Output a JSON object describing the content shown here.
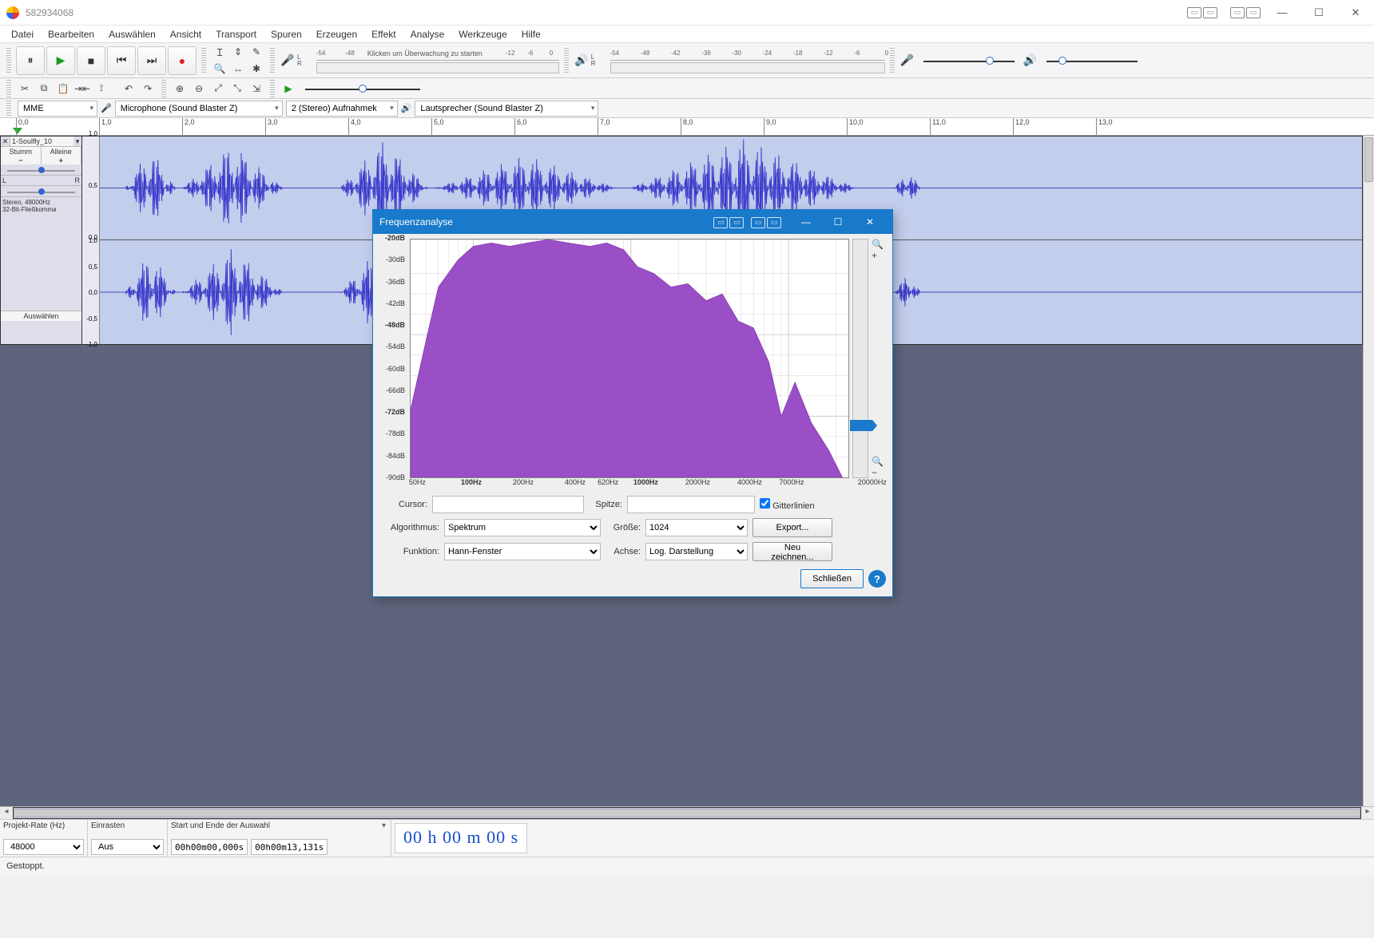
{
  "window": {
    "title": "582934068"
  },
  "menu": [
    "Datei",
    "Bearbeiten",
    "Auswählen",
    "Ansicht",
    "Transport",
    "Spuren",
    "Erzeugen",
    "Effekt",
    "Analyse",
    "Werkzeuge",
    "Hilfe"
  ],
  "meter_ticks": [
    "-54",
    "-48",
    "-42",
    "-36",
    "-30",
    "-24",
    "-18",
    "-12",
    "-6",
    "0"
  ],
  "rec_meter_hint": "Klicken um Überwachung zu starten",
  "rec_meter_left_ticks": [
    "-54",
    "-48"
  ],
  "rec_meter_right_ticks": [
    "-12",
    "-6",
    "0"
  ],
  "devices": {
    "host": "MME",
    "input": "Microphone (Sound Blaster Z)",
    "channels": "2 (Stereo) Aufnahmek",
    "output": "Lautsprecher (Sound Blaster Z)"
  },
  "ruler_ticks": [
    "0,0",
    "1,0",
    "2,0",
    "3,0",
    "4,0",
    "5,0",
    "6,0",
    "7,0",
    "8,0",
    "9,0",
    "10,0",
    "11,0",
    "12,0",
    "13,0"
  ],
  "track": {
    "name": "1-Soulfly_10",
    "mute": "Stumm",
    "solo": "Alleine",
    "L": "L",
    "R": "R",
    "info1": "Stereo, 48000Hz",
    "info2": "32-Bit-Fließkomma",
    "select": "Auswählen",
    "vticks": [
      "1,0",
      "0,5",
      "0,0",
      "-0,5",
      "-1,0"
    ]
  },
  "bottom": {
    "rate_label": "Projekt-Rate (Hz)",
    "rate_value": "48000",
    "snap_label": "Einrasten",
    "snap_value": "Aus",
    "sel_label": "Start und Ende der Auswahl",
    "sel_start": "00h00m00,000s",
    "sel_end": "00h00m13,131s",
    "timecode": "00 h 00 m 00 s",
    "status": "Gestoppt."
  },
  "dialog": {
    "title": "Frequenzanalyse",
    "y_ticks": [
      {
        "v": "-20dB",
        "bold": true
      },
      {
        "v": "-30dB"
      },
      {
        "v": "-36dB"
      },
      {
        "v": "-42dB"
      },
      {
        "v": "-48dB",
        "bold": true
      },
      {
        "v": "-54dB"
      },
      {
        "v": "-60dB"
      },
      {
        "v": "-66dB"
      },
      {
        "v": "-72dB",
        "bold": true
      },
      {
        "v": "-78dB"
      },
      {
        "v": "-84dB"
      },
      {
        "v": "-90dB"
      }
    ],
    "x_ticks": [
      "50Hz",
      "100Hz",
      "200Hz",
      "400Hz",
      "620Hz",
      "1000Hz",
      "2000Hz",
      "4000Hz",
      "7000Hz",
      "20000Hz"
    ],
    "cursor_label": "Cursor:",
    "peak_label": "Spitze:",
    "grid_label": "Gitterlinien",
    "grid_checked": true,
    "algo_label": "Algorithmus:",
    "algo_value": "Spektrum",
    "size_label": "Größe:",
    "size_value": "1024",
    "func_label": "Funktion:",
    "func_value": "Hann-Fenster",
    "axis_label": "Achse:",
    "axis_value": "Log. Darstellung",
    "export": "Export...",
    "redraw": "Neu zeichnen...",
    "close": "Schließen"
  },
  "chart_data": {
    "type": "area",
    "title": "Frequenzanalyse",
    "xlabel": "Hz",
    "ylabel": "dB",
    "xscale": "log",
    "xlim": [
      40,
      24000
    ],
    "ylim": [
      -90,
      -20
    ],
    "x_ticks_hz": [
      50,
      100,
      200,
      400,
      620,
      1000,
      2000,
      4000,
      7000,
      20000
    ],
    "y_ticks_db": [
      -20,
      -30,
      -36,
      -42,
      -48,
      -54,
      -60,
      -66,
      -72,
      -78,
      -84,
      -90
    ],
    "series": [
      {
        "name": "Spektrum",
        "x_hz": [
          40,
          50,
          60,
          80,
          100,
          130,
          170,
          220,
          300,
          400,
          550,
          700,
          900,
          1100,
          1400,
          1800,
          2300,
          3000,
          3800,
          4800,
          6000,
          7500,
          9000,
          11000,
          14000,
          18000,
          22000
        ],
        "y_db": [
          -70,
          -50,
          -34,
          -26,
          -22,
          -21,
          -22,
          -21,
          -20,
          -21,
          -22,
          -21,
          -23,
          -28,
          -30,
          -34,
          -33,
          -38,
          -36,
          -44,
          -46,
          -56,
          -72,
          -62,
          -74,
          -82,
          -90
        ]
      }
    ]
  }
}
